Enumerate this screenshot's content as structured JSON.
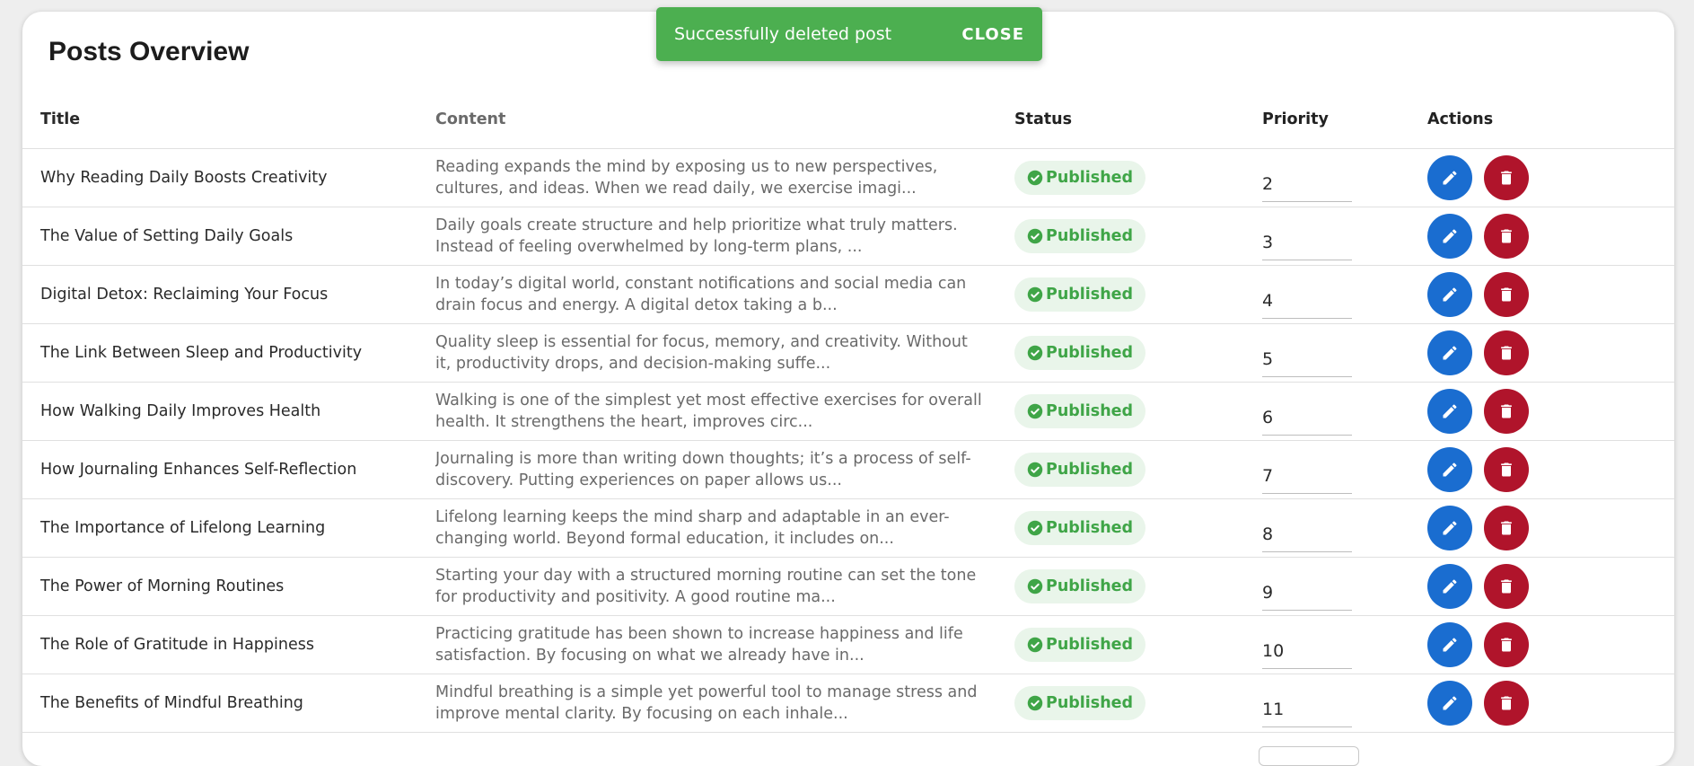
{
  "page": {
    "title": "Posts Overview"
  },
  "toast": {
    "message": "Successfully deleted post",
    "close_label": "CLOSE",
    "color": "#4caf50"
  },
  "table": {
    "headers": {
      "title": "Title",
      "content": "Content",
      "status": "Status",
      "priority": "Priority",
      "actions": "Actions"
    },
    "rows": [
      {
        "title": "Why Reading Daily Boosts Creativity",
        "content": "Reading expands the mind by exposing us to new perspectives, cultures, and ideas. When we read daily, we exercise imagi...",
        "status": "Published",
        "priority": "2"
      },
      {
        "title": "The Value of Setting Daily Goals",
        "content": "Daily goals create structure and help prioritize what truly matters. Instead of feeling overwhelmed by long-term plans, ...",
        "status": "Published",
        "priority": "3"
      },
      {
        "title": "Digital Detox: Reclaiming Your Focus",
        "content": "In today’s digital world, constant notifications and social media can drain focus and energy. A digital detox taking a b...",
        "status": "Published",
        "priority": "4"
      },
      {
        "title": "The Link Between Sleep and Productivity",
        "content": "Quality sleep is essential for focus, memory, and creativity. Without it, productivity drops, and decision-making suffe...",
        "status": "Published",
        "priority": "5"
      },
      {
        "title": "How Walking Daily Improves Health",
        "content": "Walking is one of the simplest yet most effective exercises for overall health. It strengthens the heart, improves circ...",
        "status": "Published",
        "priority": "6"
      },
      {
        "title": "How Journaling Enhances Self-Reflection",
        "content": "Journaling is more than writing down thoughts; it’s a process of self-discovery. Putting experiences on paper allows us...",
        "status": "Published",
        "priority": "7"
      },
      {
        "title": "The Importance of Lifelong Learning",
        "content": "Lifelong learning keeps the mind sharp and adaptable in an ever-changing world. Beyond formal education, it includes on...",
        "status": "Published",
        "priority": "8"
      },
      {
        "title": "The Power of Morning Routines",
        "content": "Starting your day with a structured morning routine can set the tone for productivity and positivity. A good routine ma...",
        "status": "Published",
        "priority": "9"
      },
      {
        "title": "The Role of Gratitude in Happiness",
        "content": "Practicing gratitude has been shown to increase happiness and life satisfaction. By focusing on what we already have in...",
        "status": "Published",
        "priority": "10"
      },
      {
        "title": "The Benefits of Mindful Breathing",
        "content": "Mindful breathing is a simple yet powerful tool to manage stress and improve mental clarity. By focusing on each inhale...",
        "status": "Published",
        "priority": "11"
      }
    ]
  },
  "icons": {
    "status": "check-circle-icon",
    "edit": "pencil-icon",
    "delete": "trash-icon"
  },
  "colors": {
    "edit": "#1a6dd0",
    "delete": "#b0142b",
    "published_text": "#3fa547",
    "published_bg": "#e9f5ea"
  }
}
